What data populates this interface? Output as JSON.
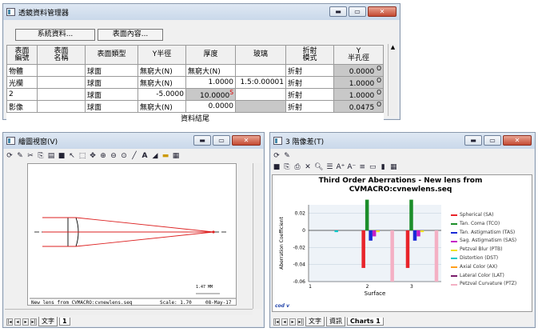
{
  "lde": {
    "title": "透鏡資料管理器",
    "buttons": {
      "system": "系統資料...",
      "surface": "表面內容..."
    },
    "headers": [
      "表面\n名稱",
      "表面\n編號",
      "表面類型",
      "Y半徑",
      "厚度",
      "玻璃",
      "折射\n模式",
      "Y\n半孔徑"
    ],
    "rows": [
      {
        "id": "物體",
        "name": "",
        "type": "球面",
        "radius": "無窮大(N)",
        "thick": "無窮大(N)",
        "glass": "",
        "mode": "折射",
        "ap": "0.0000",
        "flag": "O",
        "thickflag": ""
      },
      {
        "id": "光欄",
        "name": "",
        "type": "球面",
        "radius": "無窮大(N)",
        "thick": "1.0000",
        "glass": "1.5:0.00001",
        "mode": "折射",
        "ap": "1.0000",
        "flag": "O",
        "thickflag": ""
      },
      {
        "id": "2",
        "name": "",
        "type": "球面",
        "radius": "-5.0000",
        "thick": "10.0000",
        "glass": "",
        "mode": "折射",
        "ap": "1.0000",
        "flag": "O",
        "thickflag": "S"
      },
      {
        "id": "影像",
        "name": "",
        "type": "球面",
        "radius": "無窮大(N)",
        "thick": "0.0000",
        "glass": "",
        "mode": "折射",
        "ap": "0.0475",
        "flag": "O",
        "thickflag": ""
      }
    ],
    "footer": "資料結尾"
  },
  "drawing": {
    "title": "繪圖視窗(V)",
    "caption": "New lens from CVMACRO:cvnewlens.seq",
    "scale": "Scale:   1.70",
    "date": "08-May-17",
    "tab": "文字",
    "tab2": "1",
    "scalebar": "1.47   MM"
  },
  "charts": {
    "title": "3 階像差(T)",
    "chart_title": "Third Order Aberrations - New lens from CVMACRO:cvnewlens.seq",
    "logo": "cod v",
    "tabs": [
      "文字",
      "資訊",
      "Charts 1"
    ],
    "chart_data": {
      "type": "bar",
      "title": "Third Order Aberrations - New lens from CVMACRO:cvnewlens.seq",
      "xlabel": "Surface",
      "ylabel": "Aberration Coefficient",
      "categories": [
        "1",
        "2",
        "3"
      ],
      "ylim": [
        -0.06,
        0.03
      ],
      "yticks": [
        "0.02",
        "0",
        "-0.02",
        "-0.04",
        "-0.06"
      ],
      "series": [
        {
          "name": "Spherical (SA)",
          "color": "#e8242a",
          "values": [
            0,
            -0.044,
            -0.044
          ]
        },
        {
          "name": "Tan. Coma (TCO)",
          "color": "#1c8e2a",
          "values": [
            0,
            0.036,
            0.036
          ]
        },
        {
          "name": "Tan. Astigmatism (TAS)",
          "color": "#1a2bd6",
          "values": [
            0,
            -0.012,
            -0.012
          ]
        },
        {
          "name": "Sag. Astigmatism (SAS)",
          "color": "#c61fc6",
          "values": [
            0,
            -0.007,
            -0.007
          ]
        },
        {
          "name": "Petzval Blur (PTB)",
          "color": "#f0e020",
          "values": [
            0,
            -0.002,
            -0.002
          ]
        },
        {
          "name": "Distortion (DST)",
          "color": "#00c8c8",
          "values": [
            -0.002,
            0,
            0
          ]
        },
        {
          "name": "Axial Color (AX)",
          "color": "#ff9f1c",
          "values": [
            0,
            0,
            0
          ]
        },
        {
          "name": "Lateral Color (LAT)",
          "color": "#7a1d6a",
          "values": [
            0,
            0,
            0
          ]
        },
        {
          "name": "Petzval Curvature (PTZ)",
          "color": "#f4b0c4",
          "values": [
            0,
            -0.06,
            -0.06
          ]
        }
      ]
    }
  }
}
